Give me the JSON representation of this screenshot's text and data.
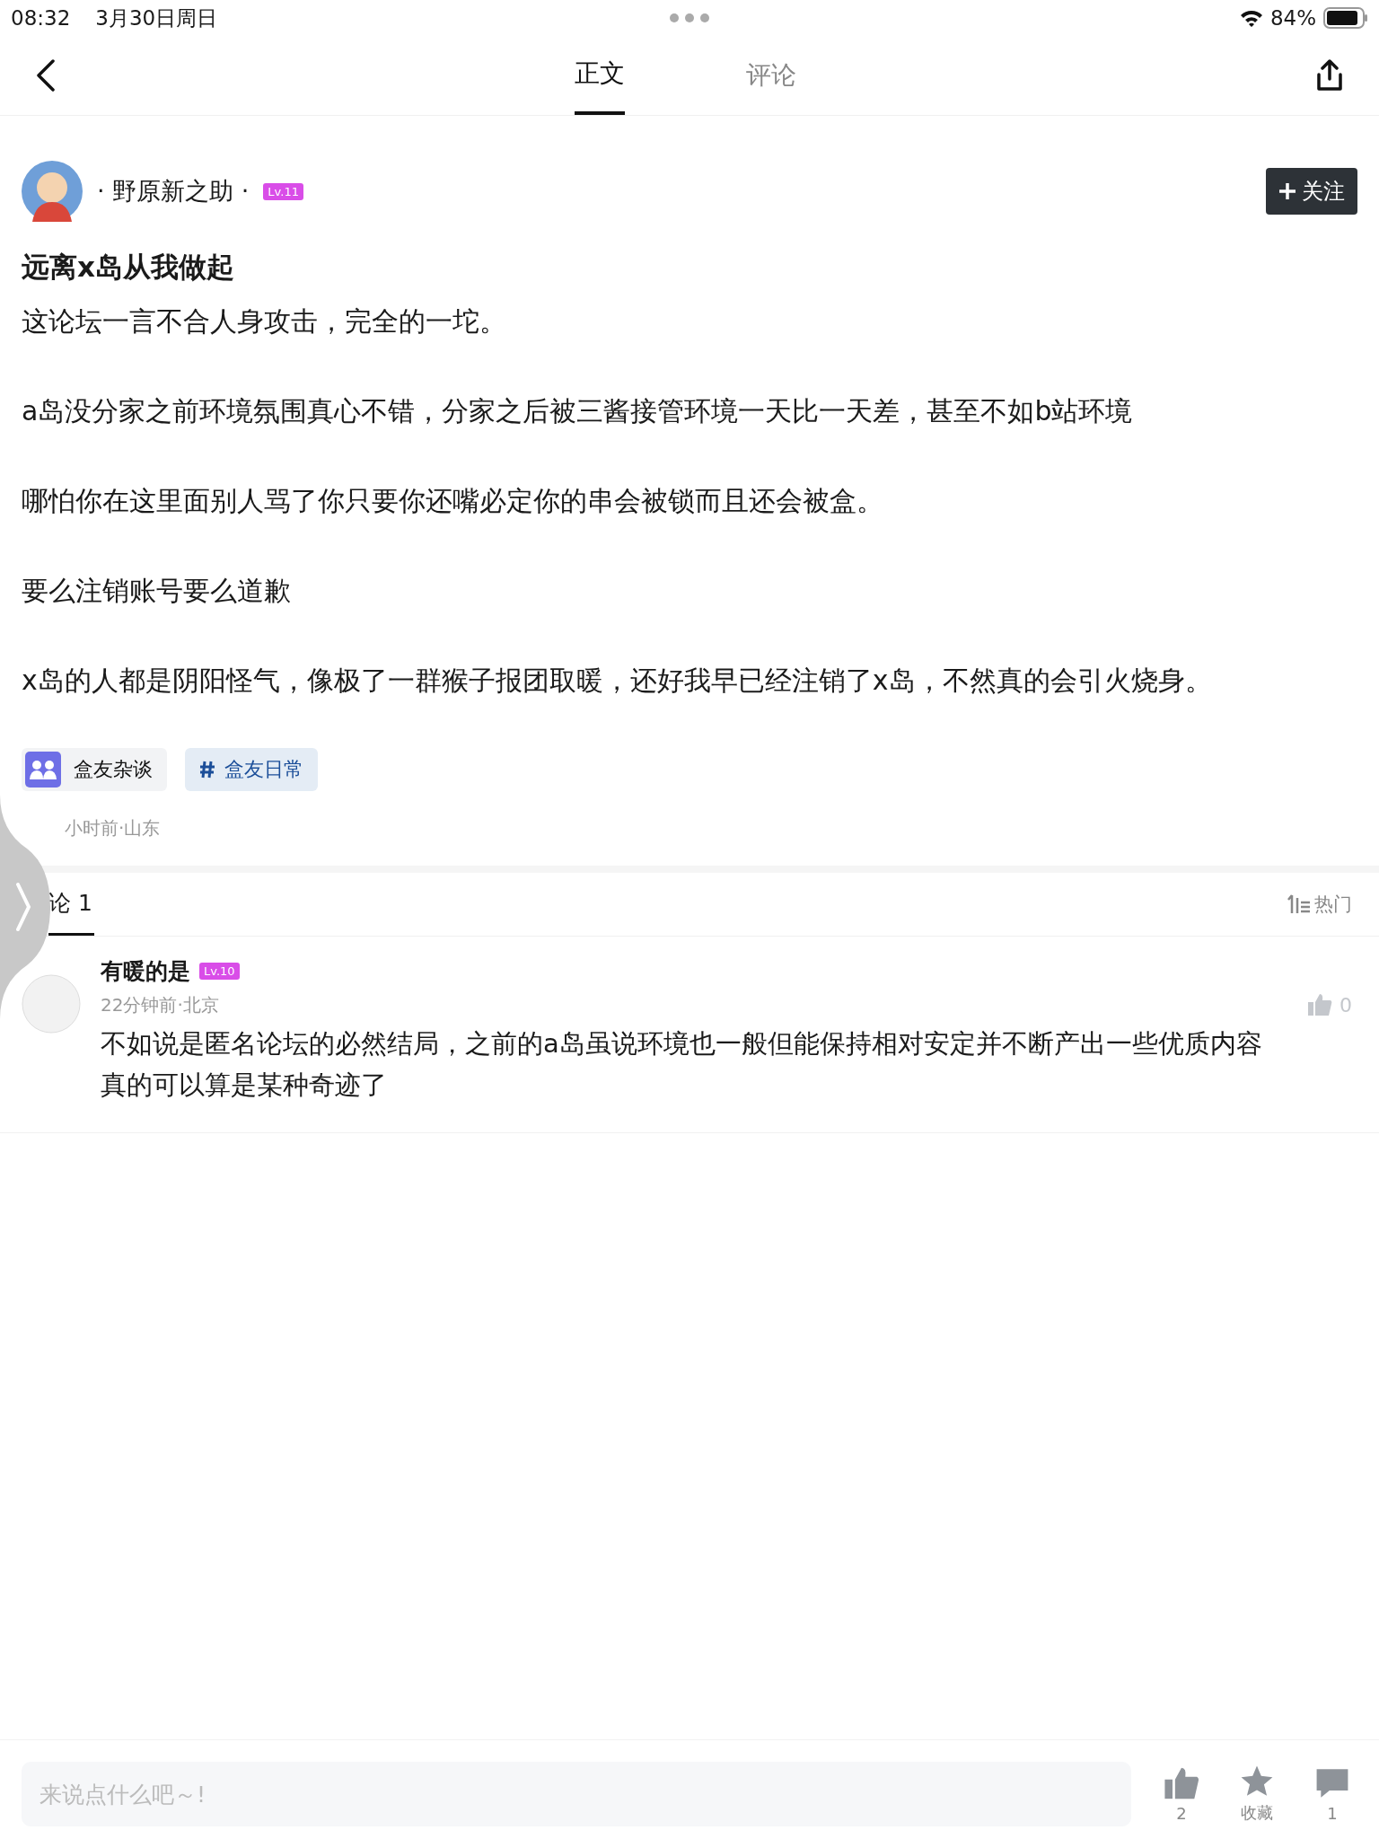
{
  "status_bar": {
    "time": "08:32",
    "date": "3月30日周日",
    "battery": "84%"
  },
  "tabs": [
    {
      "label": "正文",
      "selected": true
    },
    {
      "label": "评论",
      "selected": false
    }
  ],
  "post": {
    "author": {
      "name": "· 野原新之助 ·",
      "level": "Lv.11"
    },
    "follow_button": "关注",
    "title": "远离x岛从我做起",
    "paragraphs": [
      "这论坛一言不合人身攻击，完全的一坨。",
      "a岛没分家之前环境氛围真心不错，分家之后被三酱接管环境一天比一天差，甚至不如b站环境",
      "哪怕你在这里面别人骂了你只要你还嘴必定你的串会被锁而且还会被盒。",
      "要么注销账号要么道歉",
      "x岛的人都是阴阳怪气，像极了一群猴子报团取暖，还好我早已经注销了x岛，不然真的会引火烧身。"
    ],
    "tags": [
      {
        "kind": "board",
        "label": "盒友杂谈"
      },
      {
        "kind": "topic",
        "label": "盒友日常"
      }
    ],
    "meta": "小时前·山东"
  },
  "comments": {
    "header": "论 1",
    "sort": "热门",
    "items": [
      {
        "name": "有暖的是",
        "level": "Lv.10",
        "meta": "22分钟前·北京",
        "text": "不如说是匿名论坛的必然结局，之前的a岛虽说环境也一般但能保持相对安定并不断产出一些优质内容真的可以算是某种奇迹了",
        "likes": "0"
      }
    ]
  },
  "bottom_bar": {
    "placeholder": "来说点什么吧～!",
    "actions": [
      {
        "kind": "like",
        "label": "2"
      },
      {
        "kind": "favorite",
        "label": "收藏"
      },
      {
        "kind": "comment",
        "label": "1"
      }
    ]
  }
}
